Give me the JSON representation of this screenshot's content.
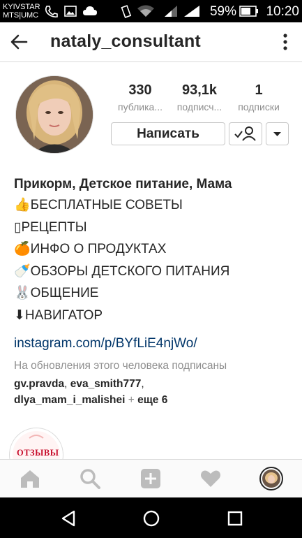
{
  "status_bar": {
    "carrier_1": "KYIVSTAR",
    "carrier_2": "MTS|UMC",
    "battery_percent": "59%",
    "time": "10:20"
  },
  "header": {
    "username": "nataly_consultant"
  },
  "stats": [
    {
      "value": "330",
      "label": "публика..."
    },
    {
      "value": "93,1k",
      "label": "подписч..."
    },
    {
      "value": "1",
      "label": "подписки"
    }
  ],
  "actions": {
    "message_label": "Написать"
  },
  "bio": {
    "name": "Прикорм, Детское питание, Мама",
    "lines": [
      "👍БЕСПЛАТНЫЕ СОВЕТЫ",
      "▯РЕЦЕПТЫ",
      "🍊ИНФО О ПРОДУКТАХ",
      "🍼ОБЗОРЫ ДЕТСКОГО ПИТАНИЯ",
      "🐰ОБЩЕНИЕ",
      "⬇НАВИГАТОР"
    ],
    "link": "instagram.com/p/BYfLiE4njWo/"
  },
  "followed_by": {
    "header": "На обновления этого человека подписаны",
    "name_1": "gv.pravda",
    "sep_1": ", ",
    "name_2": "eva_smith777",
    "sep_2": ",",
    "name_3": "dlya_mam_i_malishei",
    "plus": " + ",
    "more": "еще 6"
  },
  "highlight": {
    "label": "ОТЗЫВЫ"
  },
  "tabs": [
    "home-icon",
    "search-icon",
    "add-icon",
    "heart-icon",
    "profile-avatar"
  ],
  "colors": {
    "link": "#003569",
    "secondary_text": "#8e8e8e",
    "border": "#dbdbdb"
  }
}
